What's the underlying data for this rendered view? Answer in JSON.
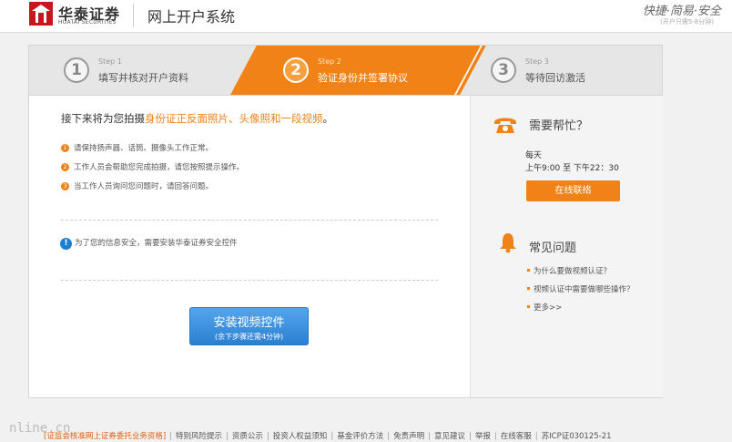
{
  "header": {
    "brand_cn": "华泰证券",
    "brand_en": "HUATAI SECURITIES",
    "system_title": "网上开户系统",
    "slogan": "快捷·简易·安全",
    "slogan_sub": "(开户只需5-8分钟)"
  },
  "steps": [
    {
      "num": "1",
      "label": "Step 1",
      "text": "填写并核对开户资料",
      "state": "done"
    },
    {
      "num": "2",
      "label": "Step 2",
      "text": "验证身份并签署协议",
      "state": "active"
    },
    {
      "num": "3",
      "label": "Step 3",
      "text": "等待回访激活",
      "state": "pending"
    }
  ],
  "main": {
    "intro_prefix": "接下来将为您拍摄",
    "intro_highlight": "身份证正反面照片、头像照和一段视频",
    "intro_suffix": "。",
    "instructions": [
      {
        "num": "1",
        "text": "请保持扬声器、话筒、摄像头工作正常。"
      },
      {
        "num": "2",
        "text": "工作人员会帮助您完成拍摄，请您按照提示操作。"
      },
      {
        "num": "3",
        "text": "当工作人员询问您问题时，请回答问题。"
      }
    ],
    "security_note": "为了您的信息安全，需要安装华泰证券安全控件",
    "install_button": {
      "label": "安装视频控件",
      "sub": "(余下步骤还需4分钟)"
    }
  },
  "sidebar": {
    "help_title": "需要帮忙？",
    "help_days": "每天",
    "help_hours": "上午9:00 至 下午22：30",
    "contact_button": "在线联络",
    "faq_title": "常见问题",
    "faq_items": [
      "为什么要做视频认证？",
      "视频认证中需要做哪些操作？",
      "更多>>"
    ]
  },
  "footer": {
    "watermark": "nline.cn",
    "links": [
      "[证监会核准网上证券委托业务资格]",
      "特别风险提示",
      "资质公示",
      "投资人权益须知",
      "基金评价方法",
      "免责声明",
      "意见建议",
      "举报",
      "在线客服",
      "苏ICP证030125-21"
    ]
  },
  "colors": {
    "accent": "#f08218",
    "button_blue": "#2b80d0"
  }
}
